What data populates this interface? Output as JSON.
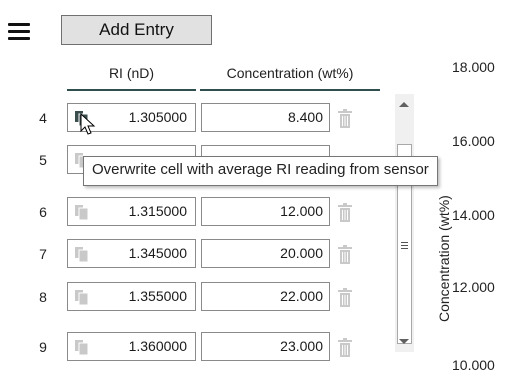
{
  "toolbar": {
    "menu_icon": "hamburger-menu-icon",
    "add_entry_label": "Add Entry"
  },
  "table": {
    "headers": {
      "ri": "RI (nD)",
      "concentration": "Concentration (wt%)"
    },
    "rows": [
      {
        "num": "4",
        "ri": "1.305000",
        "conc": "8.400"
      },
      {
        "num": "5",
        "ri": "",
        "conc": ""
      },
      {
        "num": "6",
        "ri": "1.315000",
        "conc": "12.000"
      },
      {
        "num": "7",
        "ri": "1.345000",
        "conc": "20.000"
      },
      {
        "num": "8",
        "ri": "1.355000",
        "conc": "22.000"
      },
      {
        "num": "9",
        "ri": "1.360000",
        "conc": "23.000"
      }
    ]
  },
  "tooltip": {
    "text": "Overwrite cell with average RI reading from sensor"
  },
  "chart_edge": {
    "ticks": [
      "18.000",
      "16.000",
      "14.000",
      "12.000",
      "10.000"
    ],
    "ylabel": "Concentration (wt%)"
  },
  "colors": {
    "header_underline": "#2f4f4f",
    "copy_icon_active": "#3c4f4f",
    "copy_icon_inactive": "#c9c9c9",
    "trash_icon": "#c9c9c9"
  }
}
